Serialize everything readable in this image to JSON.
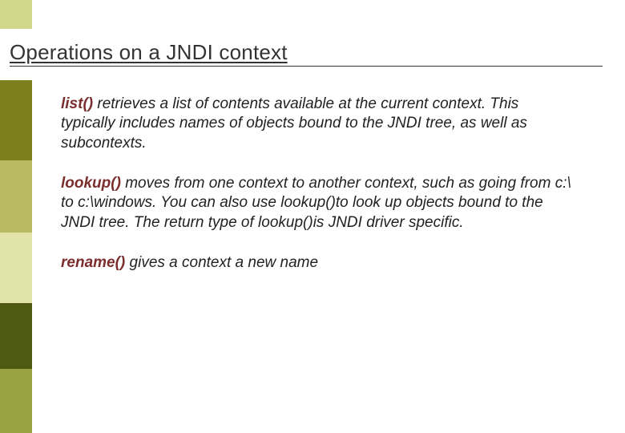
{
  "title": "Operations on a JNDI context",
  "sidebar_colors": {
    "c1": "#D2D68B",
    "c2": "#FFFFFF",
    "c3": "#7C7F1E",
    "c4": "#B8BB62",
    "c5": "#E1E3A8",
    "c6": "#4E5A12",
    "c7": "#9AA241"
  },
  "paragraphs": [
    {
      "fn": "list()",
      "text": " retrieves a list of contents available at the current context. This typically includes names of objects bound to the JNDI tree, as well as subcontexts."
    },
    {
      "fn": "lookup()",
      "text": " moves from one context to another context, such as going from c:\\ to c:\\windows. You can also use lookup()to look up objects bound to the JNDI tree. The return type of lookup()is JNDI driver specific."
    },
    {
      "fn": "rename()",
      "text": " gives a context a new name"
    }
  ]
}
